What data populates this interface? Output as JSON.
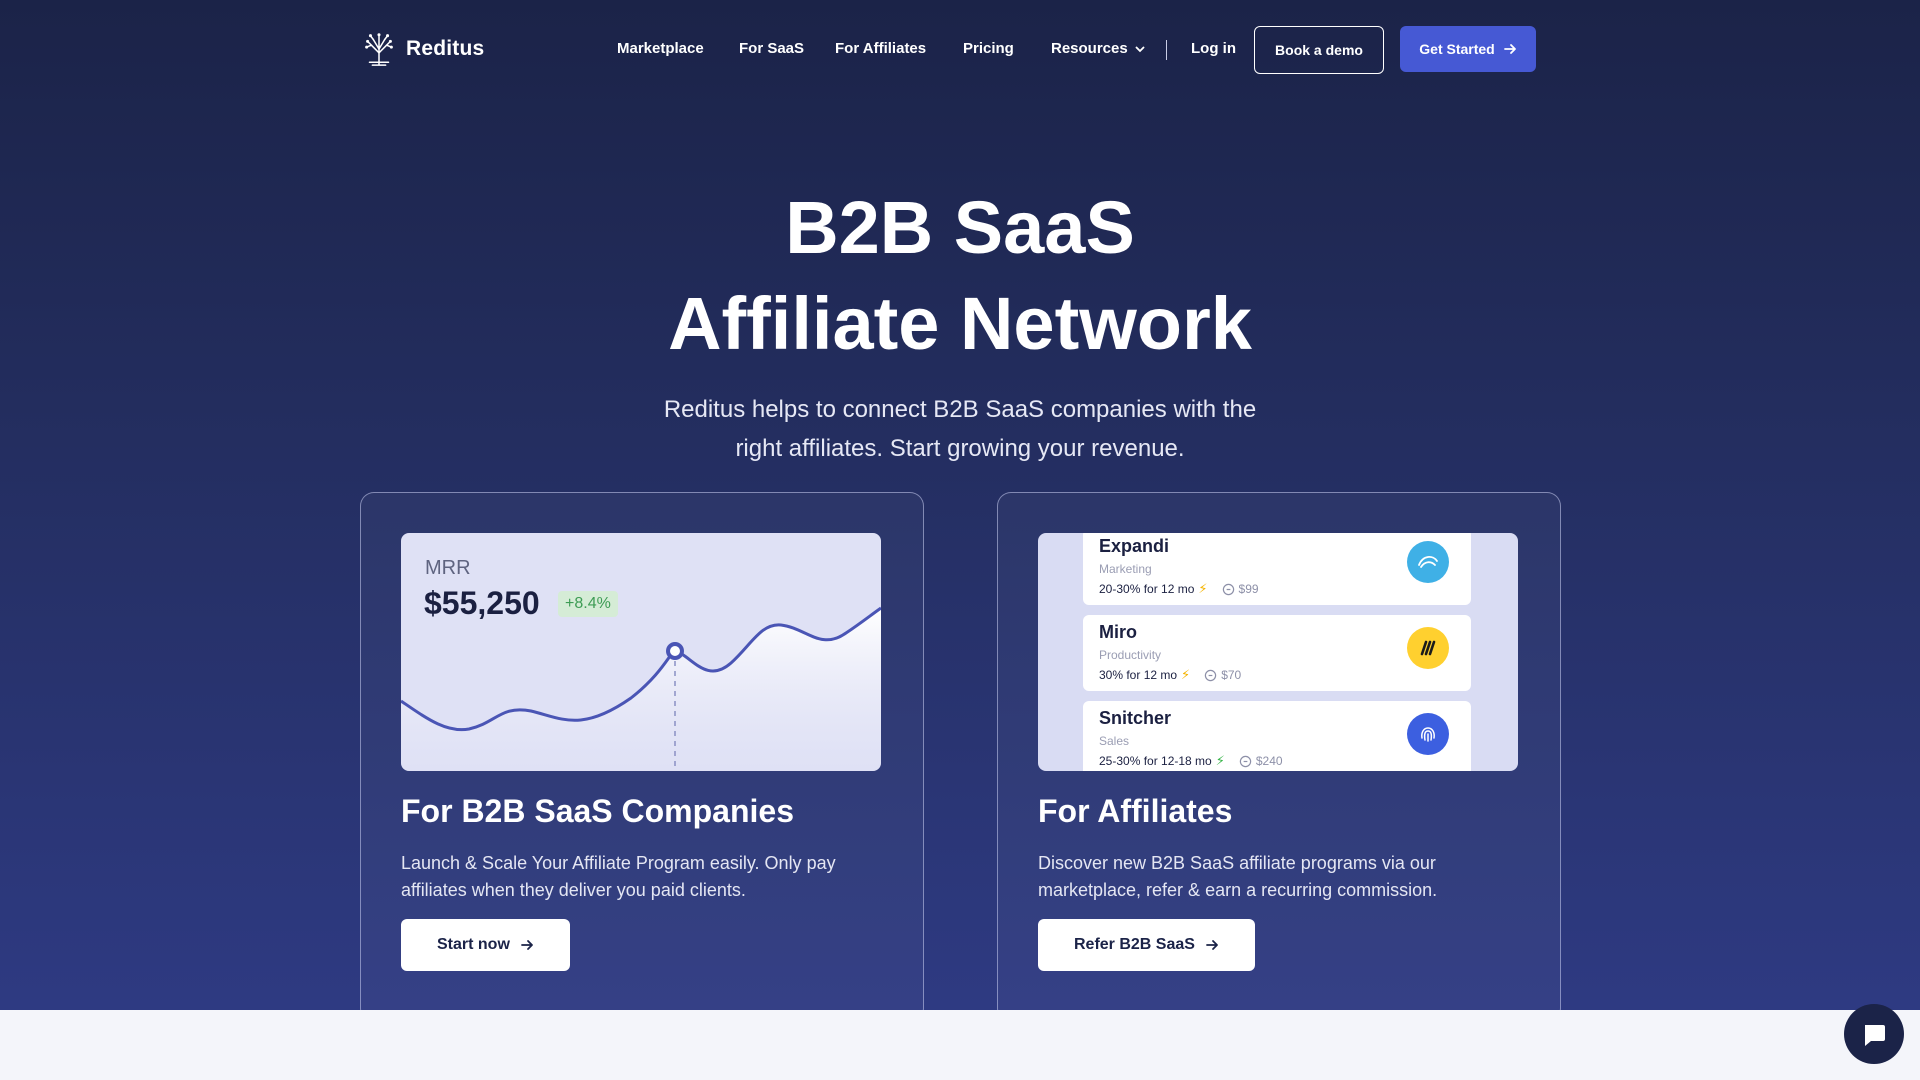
{
  "brand": {
    "name": "Reditus",
    "logo_icon": "tree-logo-icon"
  },
  "nav": {
    "links": [
      "Marketplace",
      "For SaaS",
      "For Affiliates",
      "Pricing",
      "Resources"
    ],
    "login": "Log in",
    "demo": "Book a demo",
    "started": "Get Started"
  },
  "hero": {
    "title_line1": "B2B SaaS",
    "title_line2": "Affiliate Network",
    "subtitle": "Reditus helps to connect B2B SaaS companies with the right affiliates. Start growing your revenue."
  },
  "saas_card": {
    "mrr_label": "MRR",
    "mrr_value": "$55,250",
    "mrr_change": "+8.4%",
    "title": "For B2B SaaS Companies",
    "description": "Launch & Scale Your Affiliate Program easily. Only pay affiliates when they deliver you paid clients.",
    "button": "Start now"
  },
  "affiliate_card": {
    "programs": [
      {
        "name": "Expandi",
        "category": "Marketing",
        "commission": "20-30% for 12 mo",
        "price": "$99",
        "logo": "expandi-logo-icon",
        "color": "#3fb0e6"
      },
      {
        "name": "Miro",
        "category": "Productivity",
        "commission": "30% for 12 mo",
        "price": "$70",
        "logo": "miro-logo-icon",
        "color": "#ffd02f"
      },
      {
        "name": "Snitcher",
        "category": "Sales",
        "commission": "25-30% for 12-18 mo",
        "price": "$240",
        "logo": "fingerprint-icon",
        "color": "#3c5fe0"
      }
    ],
    "title": "For Affiliates",
    "description": "Discover new B2B SaaS affiliate programs via our marketplace, refer & earn a recurring commission.",
    "button": "Refer B2B SaaS"
  },
  "colors": {
    "accent": "#4659d4",
    "hero_top": "#1b2348",
    "hero_bottom": "#2e3a82",
    "positive": "#3e9c55"
  }
}
